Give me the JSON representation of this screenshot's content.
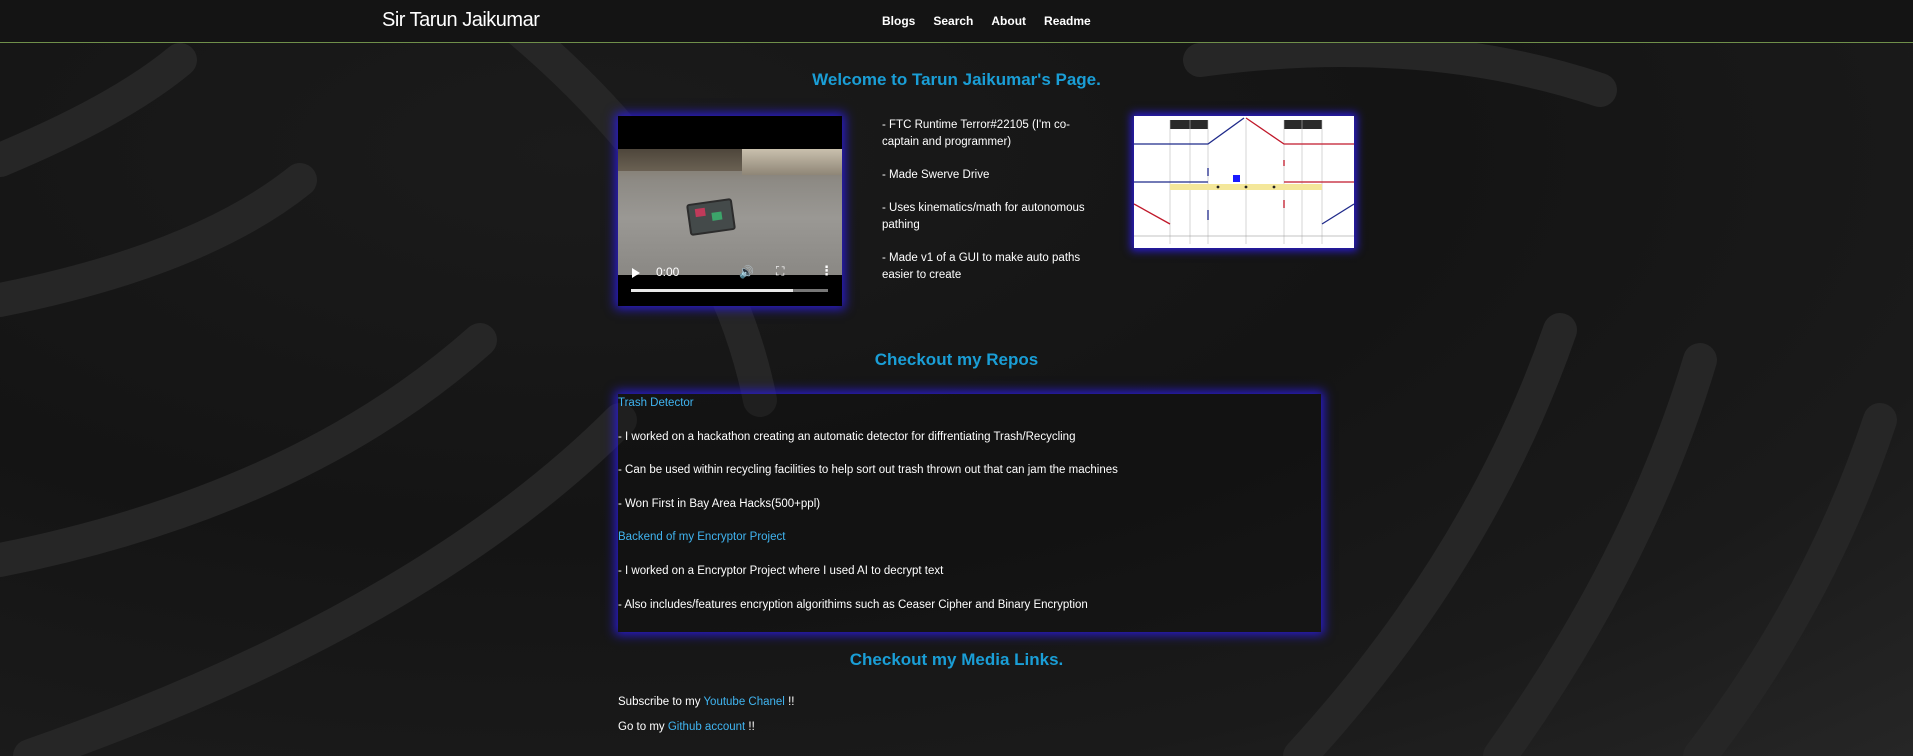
{
  "site": {
    "brand": "Sir Tarun Jaikumar",
    "nav": [
      {
        "label": "Blogs"
      },
      {
        "label": "Search"
      },
      {
        "label": "About"
      },
      {
        "label": "Readme"
      }
    ],
    "accent_color": "#1a9ed6",
    "link_color": "#40b4f0",
    "glow_color": "#2a1ccf"
  },
  "welcome": {
    "title": "Welcome to Tarun Jaikumar's Page.",
    "video": {
      "time": "0:00",
      "progress": 0.82,
      "controls": [
        "play-icon",
        "volume-icon",
        "fullscreen-icon",
        "more-options-icon"
      ]
    },
    "notes": [
      "- FTC Runtime Terror#22105 (I'm co-captain and programmer)",
      "- Made Swerve Drive",
      "- Uses kinematics/math for autonomous pathing",
      "- Made v1 of a GUI to make auto paths easier to create"
    ]
  },
  "repos": {
    "title": "Checkout my Repos",
    "items": [
      {
        "name": "Trash Detector",
        "bullets": [
          "- I worked on a hackathon creating an automatic detector for diffrentiating Trash/Recycling",
          "- Can be used within recycling facilities to help sort out trash thrown out that can jam the machines",
          "- Won First in Bay Area Hacks(500+ppl)"
        ]
      },
      {
        "name": "Backend of my Encryptor Project",
        "bullets": [
          "- I worked on a Encryptor Project where I used AI to decrypt text",
          "- Also includes/features encryption algorithims such as Ceaser Cipher and Binary Encryption"
        ]
      }
    ]
  },
  "media": {
    "title": "Checkout my Media Links.",
    "youtube": {
      "prefix": "Subscribe to my ",
      "link": "Youtube Chanel",
      "suffix": " !!"
    },
    "github": {
      "prefix": "Go to my ",
      "link": "Github account",
      "suffix": " !!"
    }
  }
}
